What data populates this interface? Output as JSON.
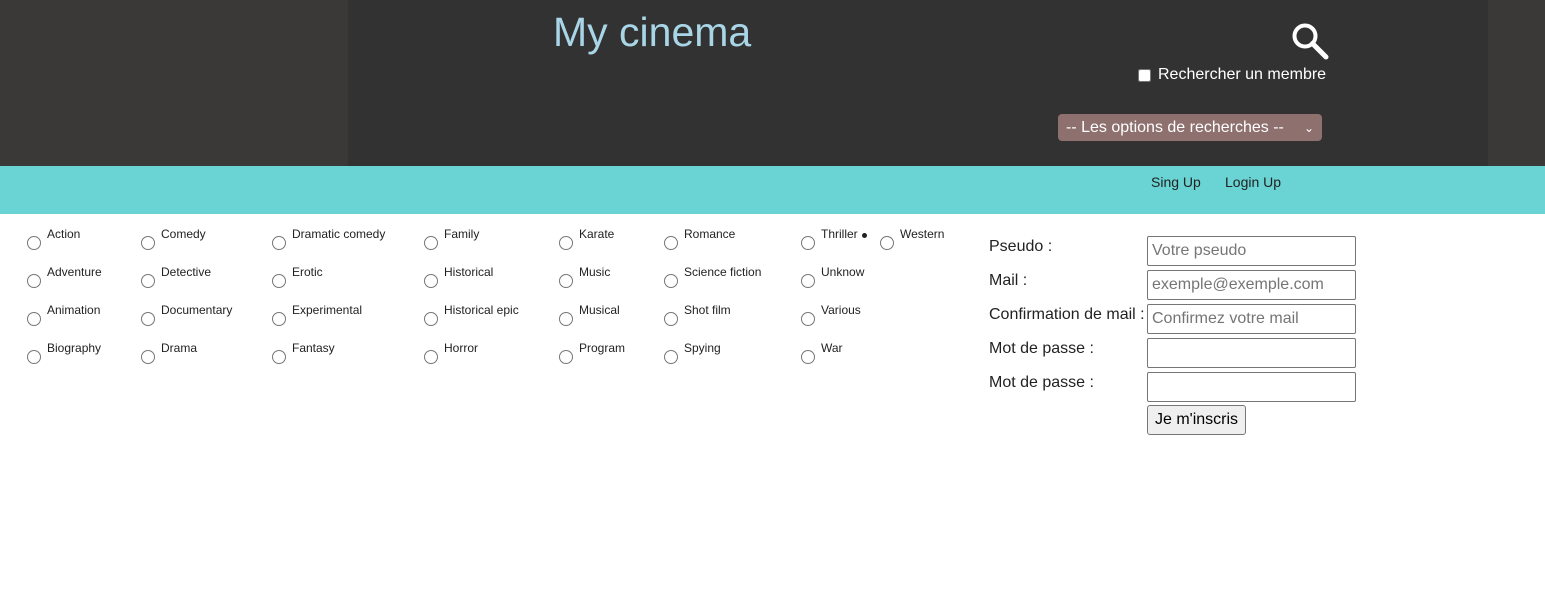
{
  "header": {
    "title": "My cinema",
    "member_search_label": "Rechercher un membre",
    "search_options": "-- Les options de recherches --"
  },
  "nav": {
    "signup": "Sing Up",
    "login": "Login Up"
  },
  "genres": {
    "col1": [
      "Action",
      "Adventure",
      "Animation",
      "Biography"
    ],
    "col2": [
      "Comedy",
      "Detective",
      "Documentary",
      "Drama"
    ],
    "col3": [
      "Dramatic comedy",
      "Erotic",
      "Experimental",
      "Fantasy"
    ],
    "col4": [
      "Family",
      "Historical",
      "Historical epic",
      "Horror"
    ],
    "col5": [
      "Karate",
      "Music",
      "Musical",
      "Program"
    ],
    "col6": [
      "Romance",
      "Science fiction",
      "Shot film",
      "Spying"
    ],
    "col7": [
      "Thriller",
      "Unknow",
      "Various",
      "War"
    ],
    "col8": [
      "Western"
    ]
  },
  "form": {
    "pseudo_label": "Pseudo :",
    "pseudo_placeholder": "Votre pseudo",
    "mail_label": "Mail :",
    "mail_placeholder": "exemple@exemple.com",
    "mail_confirm_label": "Confirmation de mail :",
    "mail_confirm_placeholder": "Confirmez votre mail",
    "password_label": "Mot de passe :",
    "password_confirm_label": "Mot de passe :",
    "submit": "Je m'inscris"
  },
  "colors": {
    "header_bg": "#3a3938",
    "header_center_bg": "#333233",
    "title": "#a9d6e6",
    "navbar": "#6ad3d3",
    "select_bg": "#8e706f"
  }
}
